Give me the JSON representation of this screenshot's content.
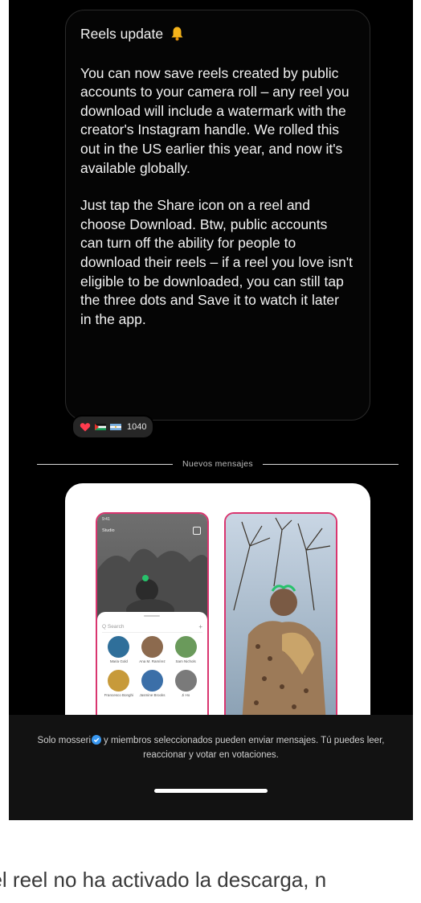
{
  "message": {
    "title": "Reels update",
    "title_icon": "bell-icon",
    "paragraphs": [
      "You can now save reels created by public accounts to your camera roll – any reel you download will include a watermark with the creator's Instagram handle. We rolled this out in the US earlier this year, and now it's available globally.",
      "Just tap the Share icon on a reel and choose Download. Btw, public accounts can turn off the ability for people to download their reels – if a reel you love isn't eligible to be downloaded, you can still tap the three dots and Save it to watch it later in the app."
    ],
    "reactions": {
      "icons": [
        "red-heart-icon",
        "palestine-flag-icon",
        "argentina-flag-icon"
      ],
      "count": "1040"
    }
  },
  "divider": {
    "label": "Nuevos mensajes"
  },
  "attachment": {
    "left_screen": {
      "status": "9:41",
      "top_label": "Studio",
      "search_placeholder": "Q Search",
      "contacts": [
        "Maria Gold",
        "Ana M. Ramírez",
        "Sam Nichols",
        "Francesco Bonghi",
        "Jasmine Brooks",
        "Ji Ho"
      ]
    }
  },
  "footer": {
    "note_prefix": "Solo mosseri",
    "note_suffix": "y miembros seleccionados pueden enviar mensajes. Tú puedes leer, reaccionar y votar en votaciones.",
    "badge_color": "#3897f0"
  },
  "caption": {
    "text": "del reel no ha activado la descarga, n"
  },
  "colors": {
    "background": "#000000",
    "bubble_border": "#2a2a2a",
    "accent_border": "#d9356f"
  }
}
